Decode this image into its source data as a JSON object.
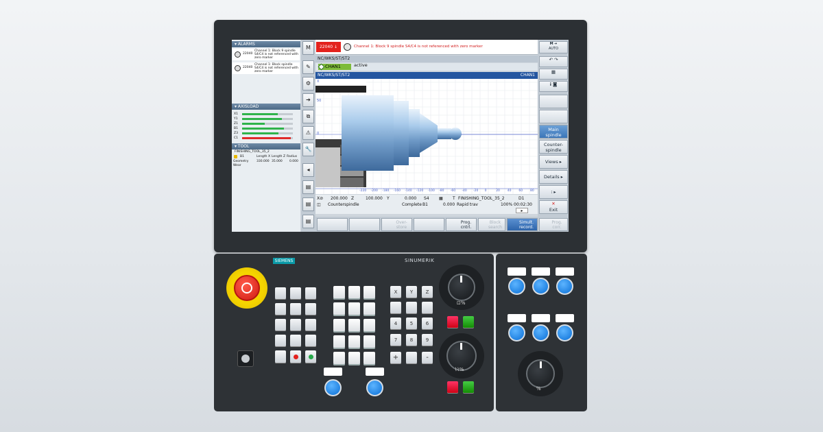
{
  "screen": {
    "alarms_panel": {
      "title": "ALARMS",
      "items": [
        {
          "number": "22040",
          "message": "Channel 1: Block 9 spindle S4/C4 is not referenced with zero marker"
        },
        {
          "number": "22040",
          "message": "Channel 1: Block spindle S4/C4 is not referenced with zero marker"
        }
      ]
    },
    "axisload_panel": {
      "title": "AXISLOAD",
      "axes": [
        {
          "name": "X1",
          "load": 0.7
        },
        {
          "name": "Y1",
          "load": 0.78
        },
        {
          "name": "Z1",
          "load": 0.45
        },
        {
          "name": "B1",
          "load": 0.82
        },
        {
          "name": "Z3",
          "load": 0.72
        },
        {
          "name": "C1",
          "load": 0.96,
          "color": "#e02a2a"
        }
      ]
    },
    "tool_panel": {
      "title": "TOOL",
      "tool_name": "FINISHING_TOOL_35_2",
      "header": [
        "B1",
        "Length X",
        "Length Z",
        "Radius"
      ],
      "rows": [
        {
          "label": "Geometry",
          "values": [
            "330.000",
            "35.000",
            "0.000"
          ]
        },
        {
          "label": "Wear",
          "values": []
        }
      ]
    },
    "alarm_bar": {
      "number": "22040",
      "text": "Channel 1: Block 9 spindle S4/C4 is not referenced with zero marker"
    },
    "path": "NC/WKS/ST/ST2",
    "channel": {
      "name": "CHAN1",
      "state": "active"
    },
    "graph_header": {
      "path": "NC/WKS/ST/ST2",
      "channel": "CHAN1"
    },
    "graph": {
      "y_ticks": [
        "50",
        "0",
        "-50",
        "-100"
      ],
      "x_ticks": [
        "-220",
        "-200",
        "-180",
        "-160",
        "-140",
        "-120",
        "-100",
        "-80",
        "-60",
        "-40",
        "-20",
        "0",
        "20",
        "40",
        "60",
        "80"
      ],
      "y_axis_label": "X"
    },
    "status": {
      "x_label": "X⊘",
      "x_value": "200.000",
      "z_label": "Z",
      "z_value": "100.000",
      "y_label": "Y",
      "s_value": "0.000",
      "s_label": "S4",
      "tool_label": "T",
      "tool": "FINISHING_TOOL_35_2",
      "d_label": "D1",
      "spindle": "Counterspindle",
      "complete": "Complete",
      "complete_unit": "B1",
      "rapid_value": "0.000",
      "rapid_label": "Rapid trav",
      "override": "100%",
      "time": "00:02:30"
    },
    "right_softkeys": {
      "mode": "AUTO",
      "main_spindle": "Main spindle",
      "counter_spindle": "Counter-spindle",
      "views": "Views",
      "details": "Details",
      "exit": "Exit"
    },
    "bottom_softkeys": [
      {
        "label": "Over- store",
        "disabled": true
      },
      {
        "label": "Prog. cntrl.",
        "disabled": false
      },
      {
        "label": "Block search",
        "disabled": true
      },
      {
        "label": "Simult. record.",
        "active": true
      },
      {
        "label": "Prog. corr.",
        "disabled": true
      }
    ]
  },
  "operator_panel": {
    "brand": "SIEMENS",
    "product": "SINUMERIK",
    "axis_keys": [
      "X",
      "Y",
      "Z",
      "4",
      "5",
      "6",
      "7",
      "8",
      "9",
      "+",
      "-"
    ],
    "feed_dial_ticks": [
      "0",
      "10",
      "30",
      "50",
      "70",
      "90",
      "100",
      "110",
      "120"
    ],
    "spindle_dial_ticks": [
      "50",
      "55",
      "60",
      "65",
      "70",
      "75",
      "80",
      "85",
      "90",
      "95",
      "100",
      "105",
      "110",
      "115",
      "120"
    ]
  },
  "colors": {
    "accent_blue": "#0a6fd6",
    "alarm_red": "#e3221d",
    "active_green": "#7dbb3a",
    "graph_header": "#2456a0"
  }
}
